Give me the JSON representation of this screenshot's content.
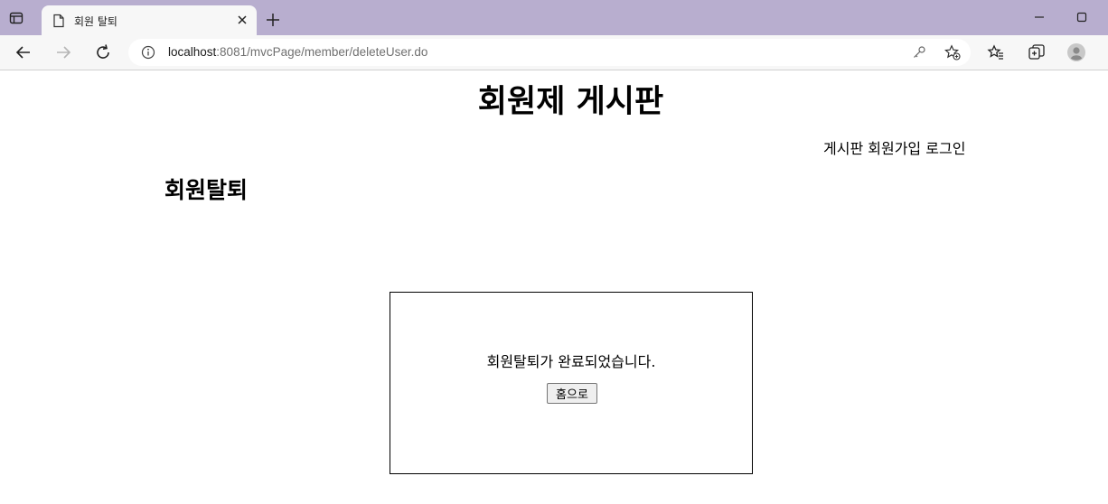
{
  "browser": {
    "tab": {
      "title": "회원 탈퇴"
    },
    "address": {
      "host": "localhost",
      "rest": ":8081/mvcPage/member/deleteUser.do"
    }
  },
  "page": {
    "site_title": "회원제 게시판",
    "menu": [
      {
        "label": "게시판"
      },
      {
        "label": "회원가입"
      },
      {
        "label": "로그인"
      }
    ],
    "section_title": "회원탈퇴",
    "result": {
      "message": "회원탈퇴가 완료되었습니다.",
      "home_button": "홈으로"
    }
  }
}
